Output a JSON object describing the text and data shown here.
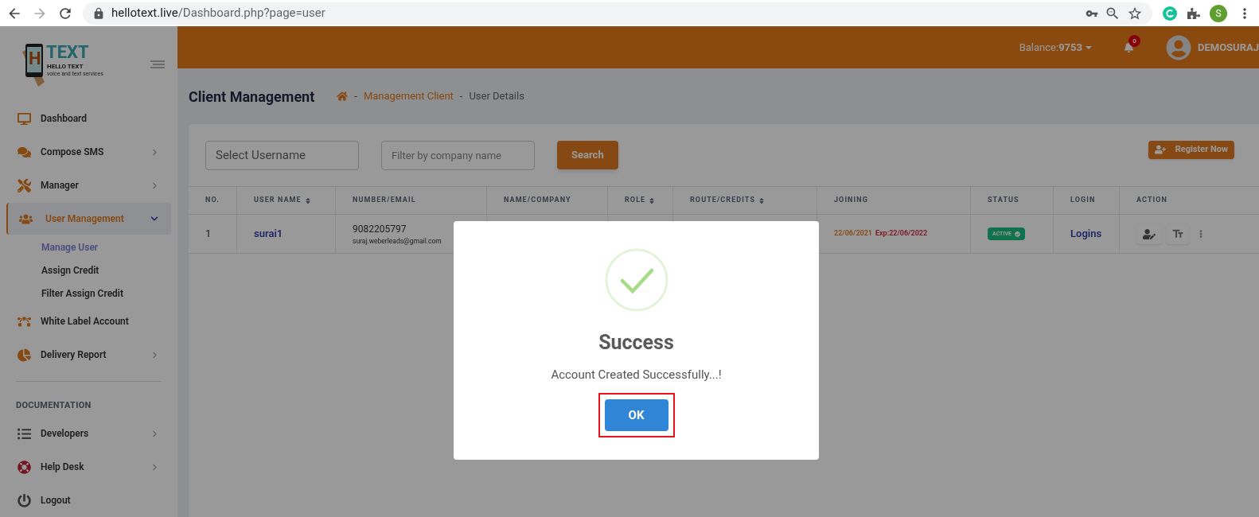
{
  "browser": {
    "url_host": "hellotext.live",
    "url_path": "/Dashboard.php?page=user",
    "profile_initial": "S"
  },
  "logo": {
    "letter": "H",
    "word": "TEXT",
    "name": "HELLO TEXT",
    "tagline": "voice and text services"
  },
  "header": {
    "balance_label": "Balance:",
    "balance_value": "9753",
    "notification_count": "0",
    "username": "DEMOSURAJ"
  },
  "sidebar": {
    "items": [
      {
        "kind": "item",
        "label": "Dashboard",
        "chevron": false,
        "selected": false
      },
      {
        "kind": "item",
        "label": "Compose SMS",
        "chevron": true,
        "selected": false
      },
      {
        "kind": "item",
        "label": "Manager",
        "chevron": true,
        "selected": false
      },
      {
        "kind": "item",
        "label": "User Management",
        "chevron": true,
        "selected": true,
        "expanded": true,
        "children": [
          {
            "label": "Manage User",
            "selected": true
          },
          {
            "label": "Assign Credit",
            "selected": false
          },
          {
            "label": "Filter Assign Credit",
            "selected": false
          }
        ]
      },
      {
        "kind": "item",
        "label": "White Label Account",
        "chevron": false,
        "selected": false
      },
      {
        "kind": "item",
        "label": "Delivery Report",
        "chevron": true,
        "selected": false
      },
      {
        "kind": "section",
        "label": "DOCUMENTATION"
      },
      {
        "kind": "item",
        "label": "Developers",
        "chevron": true,
        "selected": false
      },
      {
        "kind": "item",
        "label": "Help Desk",
        "chevron": true,
        "selected": false
      },
      {
        "kind": "item",
        "label": "Logout",
        "chevron": false,
        "selected": false
      }
    ]
  },
  "page": {
    "title": "Client Management",
    "breadcrumb": [
      {
        "separator": "-",
        "label": "Management Client",
        "link": true
      },
      {
        "separator": "-",
        "label": "User Details",
        "link": false
      }
    ]
  },
  "filters": {
    "username_placeholder": "Select Username",
    "company_placeholder": "Filter by company name",
    "search_button": "Search",
    "register_button": "Register Now"
  },
  "table": {
    "columns": [
      {
        "label": "NO.",
        "sortable": false
      },
      {
        "label": "USER NAME",
        "sortable": true
      },
      {
        "label": "NUMBER/EMAIL",
        "sortable": false
      },
      {
        "label": "NAME/COMPANY",
        "sortable": false
      },
      {
        "label": "ROLE",
        "sortable": true
      },
      {
        "label": "ROUTE/CREDITS",
        "sortable": true
      },
      {
        "label": "JOINING",
        "sortable": false
      },
      {
        "label": "STATUS",
        "sortable": false
      },
      {
        "label": "LOGIN",
        "sortable": false
      },
      {
        "label": "ACTION",
        "sortable": false
      }
    ],
    "rows": [
      {
        "no": "1",
        "username": "surai1",
        "number": "9082205797",
        "email": "suraj.weberleads@gmail.com",
        "joining": "22/06/2021",
        "expiry": "Exp:22/06/2022",
        "status": "ACTIVE",
        "active": true,
        "login": "Logins"
      }
    ]
  },
  "dialog": {
    "title": "Success",
    "message": "Account Created Successfully...!",
    "button": "OK",
    "button_highlighted": true
  }
}
